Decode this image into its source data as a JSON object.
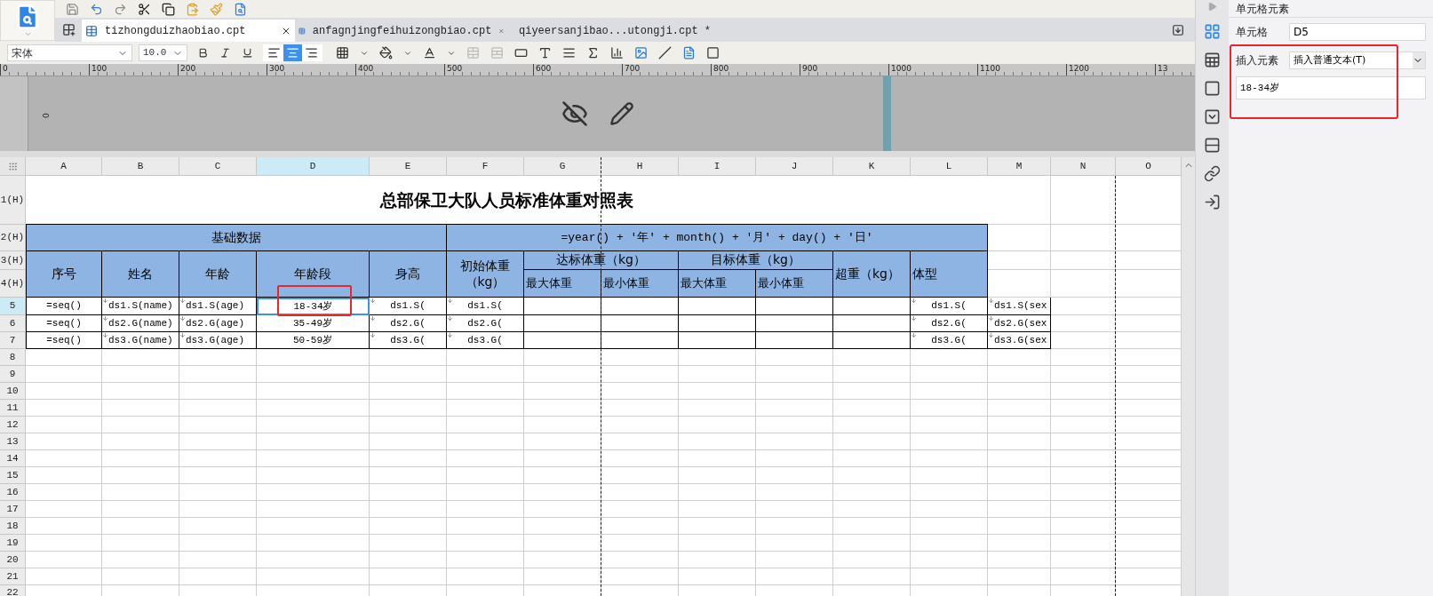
{
  "tabs": [
    {
      "label": "tizhongduizhaobiao.cpt",
      "selected": true
    },
    {
      "label": "anfagnjingfeihuizongbiao.cpt",
      "selected": false
    },
    {
      "label": "qiyeersanjibao...utongji.cpt *",
      "selected": false
    }
  ],
  "format_toolbar": {
    "font": "宋体",
    "size": "10.0",
    "alignments": [
      {
        "selected": false
      },
      {
        "selected": true
      },
      {
        "selected": false
      }
    ]
  },
  "ruler": {
    "labels": [
      "0",
      "100",
      "200",
      "300",
      "400",
      "500",
      "600",
      "700",
      "800",
      "900",
      "1000",
      "1100",
      "1200",
      "13"
    ],
    "side_label": "0"
  },
  "sheet": {
    "columns": [
      {
        "label": "A",
        "selected": false
      },
      {
        "label": "B",
        "selected": false
      },
      {
        "label": "C",
        "selected": false
      },
      {
        "label": "D",
        "selected": true
      },
      {
        "label": "E",
        "selected": false
      },
      {
        "label": "F",
        "selected": false
      },
      {
        "label": "G",
        "selected": false
      },
      {
        "label": "H",
        "selected": false
      },
      {
        "label": "I",
        "selected": false
      },
      {
        "label": "J",
        "selected": false
      },
      {
        "label": "K",
        "selected": false
      },
      {
        "label": "L",
        "selected": false
      },
      {
        "label": "M",
        "selected": false
      },
      {
        "label": "N",
        "selected": false
      },
      {
        "label": "O",
        "selected": false
      }
    ],
    "rows": [
      {
        "label": "1(H)",
        "selected": false
      },
      {
        "label": "2(H)",
        "selected": false
      },
      {
        "label": "3(H)",
        "selected": false
      },
      {
        "label": "4(H)",
        "selected": false
      },
      {
        "label": "5",
        "selected": true
      },
      {
        "label": "6",
        "selected": false
      },
      {
        "label": "7",
        "selected": false
      },
      {
        "label": "8",
        "selected": false
      },
      {
        "label": "9",
        "selected": false
      },
      {
        "label": "10",
        "selected": false
      },
      {
        "label": "11",
        "selected": false
      },
      {
        "label": "12",
        "selected": false
      },
      {
        "label": "13",
        "selected": false
      },
      {
        "label": "14",
        "selected": false
      },
      {
        "label": "15",
        "selected": false
      },
      {
        "label": "16",
        "selected": false
      },
      {
        "label": "17",
        "selected": false
      },
      {
        "label": "18",
        "selected": false
      },
      {
        "label": "19",
        "selected": false
      },
      {
        "label": "20",
        "selected": false
      },
      {
        "label": "21",
        "selected": false
      },
      {
        "label": "22",
        "selected": false
      }
    ],
    "title": "总部保卫大队人员标准体重对照表",
    "group_left": "基础数据",
    "group_right": "=year() + '年' + month() + '月' + day() + '日'",
    "header_cells": [
      "序号",
      "姓名",
      "年龄",
      "年龄段",
      "身高",
      "初始体重（kg）",
      "达标体重（kg）",
      "目标体重（kg）",
      "超重（kg）",
      "体型",
      "最大体重",
      "最小体重",
      "最大体重",
      "最小体重"
    ],
    "data_rows": [
      {
        "cells": [
          {
            "text": "=seq()",
            "expand": false,
            "selected": false
          },
          {
            "text": "ds1.S(name)",
            "expand": true,
            "selected": false
          },
          {
            "text": "ds1.S(age)",
            "expand": true,
            "selected": false
          },
          {
            "text": "18-34岁",
            "expand": false,
            "selected": true
          },
          {
            "text": "ds1.S(",
            "expand": true,
            "selected": false
          },
          {
            "text": "ds1.S(",
            "expand": true,
            "selected": false
          },
          {
            "expand": false,
            "selected": false
          },
          {
            "expand": false,
            "selected": false
          },
          {
            "expand": false,
            "selected": false
          },
          {
            "expand": false,
            "selected": false
          },
          {
            "expand": false,
            "selected": false
          },
          {
            "text": "ds1.S(",
            "expand": true,
            "selected": false
          },
          {
            "text": "ds1.S(sex",
            "expand": true,
            "selected": false
          }
        ]
      },
      {
        "cells": [
          {
            "text": "=seq()",
            "expand": false,
            "selected": false
          },
          {
            "text": "ds2.G(name)",
            "expand": true,
            "selected": false
          },
          {
            "text": "ds2.G(age)",
            "expand": true,
            "selected": false
          },
          {
            "text": "35-49岁",
            "expand": false,
            "selected": false
          },
          {
            "text": "ds2.G(",
            "expand": true,
            "selected": false
          },
          {
            "text": "ds2.G(",
            "expand": true,
            "selected": false
          },
          {
            "expand": false,
            "selected": false
          },
          {
            "expand": false,
            "selected": false
          },
          {
            "expand": false,
            "selected": false
          },
          {
            "expand": false,
            "selected": false
          },
          {
            "expand": false,
            "selected": false
          },
          {
            "text": "ds2.G(",
            "expand": true,
            "selected": false
          },
          {
            "text": "ds2.G(sex",
            "expand": true,
            "selected": false
          }
        ]
      },
      {
        "cells": [
          {
            "text": "=seq()",
            "expand": false,
            "selected": false
          },
          {
            "text": "ds3.G(name)",
            "expand": true,
            "selected": false
          },
          {
            "text": "ds3.G(age)",
            "expand": true,
            "selected": false
          },
          {
            "text": "50-59岁",
            "expand": false,
            "selected": false
          },
          {
            "text": "ds3.G(",
            "expand": true,
            "selected": false
          },
          {
            "text": "ds3.G(",
            "expand": true,
            "selected": false
          },
          {
            "expand": false,
            "selected": false
          },
          {
            "expand": false,
            "selected": false
          },
          {
            "expand": false,
            "selected": false
          },
          {
            "expand": false,
            "selected": false
          },
          {
            "expand": false,
            "selected": false
          },
          {
            "text": "ds3.G(",
            "expand": true,
            "selected": false
          },
          {
            "text": "ds3.G(sex",
            "expand": true,
            "selected": false
          }
        ]
      }
    ]
  },
  "side_tabs": [
    {
      "selected": true
    },
    {
      "selected": false
    },
    {
      "selected": false
    },
    {
      "selected": false
    },
    {
      "selected": false
    },
    {
      "selected": false
    },
    {
      "selected": false
    }
  ],
  "panel": {
    "title": "单元格元素",
    "cell_label": "单元格",
    "cell_value": "D5",
    "insert_label": "插入元素",
    "insert_value": "插入普通文本(T)",
    "content": "18-34岁"
  }
}
